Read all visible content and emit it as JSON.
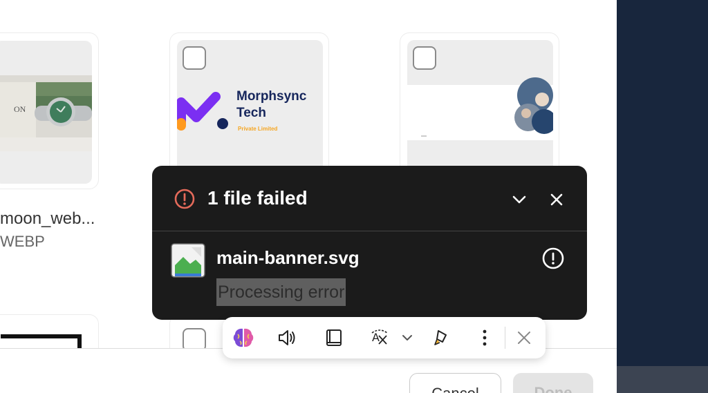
{
  "grid": {
    "cards": [
      {
        "kind": "watch-photo",
        "filename": "moon_web...",
        "filetype": "WEBP",
        "image_text": "ON"
      },
      {
        "kind": "logo",
        "logo": {
          "line1": "Morphsync",
          "line2": "Tech",
          "tagline": "Private Limited"
        }
      },
      {
        "kind": "banner-photo"
      }
    ]
  },
  "toast": {
    "title": "1 file failed",
    "file_name": "main-banner.svg",
    "status": "Processing error",
    "icons": {
      "header": "error-circle-icon",
      "collapse": "chevron-down-icon",
      "close": "close-icon",
      "file": "broken-image-file-icon",
      "item_status": "exclamation-circle-icon"
    }
  },
  "toolbar": {
    "icons": [
      "brain-ai-icon",
      "speaker-icon",
      "reader-icon",
      "translate-icon",
      "chevron-down-icon",
      "highlighter-icon",
      "more-vertical-icon",
      "close-icon"
    ]
  },
  "footer": {
    "cancel_label": "Cancel",
    "done_label": "Done"
  },
  "colors": {
    "toast_bg": "#1b1b1b",
    "error_accent": "#e46a5a",
    "navy_background": "#18263d",
    "logo_purple": "#7b2ff2",
    "logo_orange": "#ff9a1f",
    "logo_navy": "#16265c",
    "tagline_yellow": "#f5a623"
  }
}
